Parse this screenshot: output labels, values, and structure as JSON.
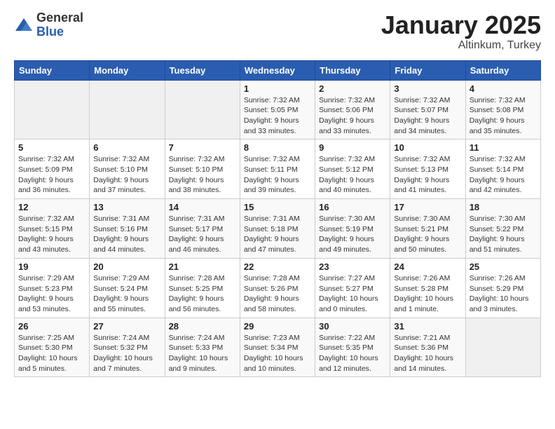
{
  "logo": {
    "general": "General",
    "blue": "Blue"
  },
  "header": {
    "title": "January 2025",
    "subtitle": "Altinkum, Turkey"
  },
  "weekdays": [
    "Sunday",
    "Monday",
    "Tuesday",
    "Wednesday",
    "Thursday",
    "Friday",
    "Saturday"
  ],
  "weeks": [
    [
      {
        "day": "",
        "info": ""
      },
      {
        "day": "",
        "info": ""
      },
      {
        "day": "",
        "info": ""
      },
      {
        "day": "1",
        "info": "Sunrise: 7:32 AM\nSunset: 5:05 PM\nDaylight: 9 hours\nand 33 minutes."
      },
      {
        "day": "2",
        "info": "Sunrise: 7:32 AM\nSunset: 5:06 PM\nDaylight: 9 hours\nand 33 minutes."
      },
      {
        "day": "3",
        "info": "Sunrise: 7:32 AM\nSunset: 5:07 PM\nDaylight: 9 hours\nand 34 minutes."
      },
      {
        "day": "4",
        "info": "Sunrise: 7:32 AM\nSunset: 5:08 PM\nDaylight: 9 hours\nand 35 minutes."
      }
    ],
    [
      {
        "day": "5",
        "info": "Sunrise: 7:32 AM\nSunset: 5:09 PM\nDaylight: 9 hours\nand 36 minutes."
      },
      {
        "day": "6",
        "info": "Sunrise: 7:32 AM\nSunset: 5:10 PM\nDaylight: 9 hours\nand 37 minutes."
      },
      {
        "day": "7",
        "info": "Sunrise: 7:32 AM\nSunset: 5:10 PM\nDaylight: 9 hours\nand 38 minutes."
      },
      {
        "day": "8",
        "info": "Sunrise: 7:32 AM\nSunset: 5:11 PM\nDaylight: 9 hours\nand 39 minutes."
      },
      {
        "day": "9",
        "info": "Sunrise: 7:32 AM\nSunset: 5:12 PM\nDaylight: 9 hours\nand 40 minutes."
      },
      {
        "day": "10",
        "info": "Sunrise: 7:32 AM\nSunset: 5:13 PM\nDaylight: 9 hours\nand 41 minutes."
      },
      {
        "day": "11",
        "info": "Sunrise: 7:32 AM\nSunset: 5:14 PM\nDaylight: 9 hours\nand 42 minutes."
      }
    ],
    [
      {
        "day": "12",
        "info": "Sunrise: 7:32 AM\nSunset: 5:15 PM\nDaylight: 9 hours\nand 43 minutes."
      },
      {
        "day": "13",
        "info": "Sunrise: 7:31 AM\nSunset: 5:16 PM\nDaylight: 9 hours\nand 44 minutes."
      },
      {
        "day": "14",
        "info": "Sunrise: 7:31 AM\nSunset: 5:17 PM\nDaylight: 9 hours\nand 46 minutes."
      },
      {
        "day": "15",
        "info": "Sunrise: 7:31 AM\nSunset: 5:18 PM\nDaylight: 9 hours\nand 47 minutes."
      },
      {
        "day": "16",
        "info": "Sunrise: 7:30 AM\nSunset: 5:19 PM\nDaylight: 9 hours\nand 49 minutes."
      },
      {
        "day": "17",
        "info": "Sunrise: 7:30 AM\nSunset: 5:21 PM\nDaylight: 9 hours\nand 50 minutes."
      },
      {
        "day": "18",
        "info": "Sunrise: 7:30 AM\nSunset: 5:22 PM\nDaylight: 9 hours\nand 51 minutes."
      }
    ],
    [
      {
        "day": "19",
        "info": "Sunrise: 7:29 AM\nSunset: 5:23 PM\nDaylight: 9 hours\nand 53 minutes."
      },
      {
        "day": "20",
        "info": "Sunrise: 7:29 AM\nSunset: 5:24 PM\nDaylight: 9 hours\nand 55 minutes."
      },
      {
        "day": "21",
        "info": "Sunrise: 7:28 AM\nSunset: 5:25 PM\nDaylight: 9 hours\nand 56 minutes."
      },
      {
        "day": "22",
        "info": "Sunrise: 7:28 AM\nSunset: 5:26 PM\nDaylight: 9 hours\nand 58 minutes."
      },
      {
        "day": "23",
        "info": "Sunrise: 7:27 AM\nSunset: 5:27 PM\nDaylight: 10 hours\nand 0 minutes."
      },
      {
        "day": "24",
        "info": "Sunrise: 7:26 AM\nSunset: 5:28 PM\nDaylight: 10 hours\nand 1 minute."
      },
      {
        "day": "25",
        "info": "Sunrise: 7:26 AM\nSunset: 5:29 PM\nDaylight: 10 hours\nand 3 minutes."
      }
    ],
    [
      {
        "day": "26",
        "info": "Sunrise: 7:25 AM\nSunset: 5:30 PM\nDaylight: 10 hours\nand 5 minutes."
      },
      {
        "day": "27",
        "info": "Sunrise: 7:24 AM\nSunset: 5:32 PM\nDaylight: 10 hours\nand 7 minutes."
      },
      {
        "day": "28",
        "info": "Sunrise: 7:24 AM\nSunset: 5:33 PM\nDaylight: 10 hours\nand 9 minutes."
      },
      {
        "day": "29",
        "info": "Sunrise: 7:23 AM\nSunset: 5:34 PM\nDaylight: 10 hours\nand 10 minutes."
      },
      {
        "day": "30",
        "info": "Sunrise: 7:22 AM\nSunset: 5:35 PM\nDaylight: 10 hours\nand 12 minutes."
      },
      {
        "day": "31",
        "info": "Sunrise: 7:21 AM\nSunset: 5:36 PM\nDaylight: 10 hours\nand 14 minutes."
      },
      {
        "day": "",
        "info": ""
      }
    ]
  ]
}
